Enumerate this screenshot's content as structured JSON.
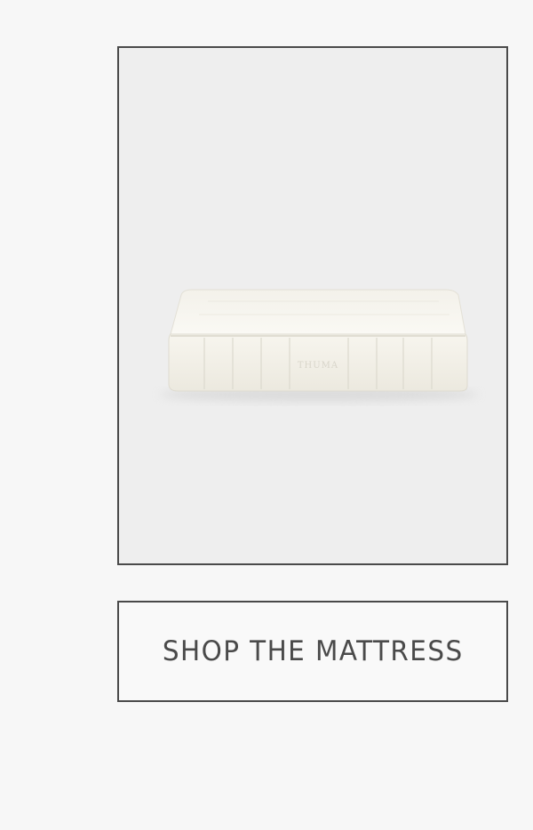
{
  "product": {
    "image_alt": "Thuma mattress",
    "brand_mark": "THUMA"
  },
  "cta": {
    "label": "SHOP THE MATTRESS"
  },
  "colors": {
    "background": "#f7f7f7",
    "frame_border": "#4a4a4a",
    "image_background": "#eeeeee",
    "mattress": "#f8f6ef",
    "text": "#4a4a4a"
  }
}
